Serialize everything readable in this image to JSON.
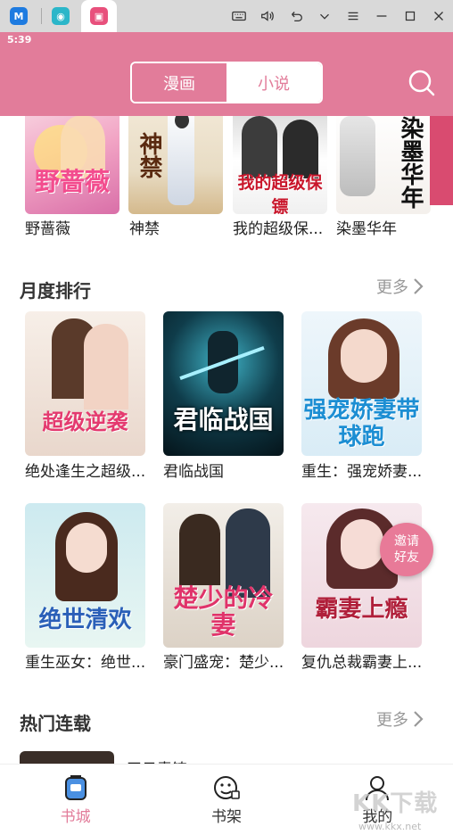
{
  "status_bar": {
    "time": "5:39"
  },
  "header": {
    "tabs": [
      {
        "label": "漫画",
        "active": false
      },
      {
        "label": "小说",
        "active": true
      }
    ],
    "accent_color": "#e27c9a"
  },
  "top_row": {
    "books": [
      {
        "name": "野蔷薇",
        "cover_text": "野蔷薇",
        "icon": "cover-image"
      },
      {
        "name": "神禁",
        "cover_text": "神禁",
        "icon": "cover-image"
      },
      {
        "name": "我的超级保...",
        "cover_text": "我的超级保镖",
        "icon": "cover-image"
      },
      {
        "name": "染墨华年",
        "cover_text": "染墨华年",
        "icon": "cover-image"
      }
    ]
  },
  "monthly": {
    "title": "月度排行",
    "more": "更多",
    "books": [
      {
        "name": "绝处逢生之超级...",
        "cover_text": "超级逆袭"
      },
      {
        "name": "君临战国",
        "cover_text": "君临战国"
      },
      {
        "name": "重生：强宠娇妻...",
        "cover_text": "强宠娇妻带球跑"
      },
      {
        "name": "重生巫女：绝世...",
        "cover_text": "绝世清欢"
      },
      {
        "name": "豪门盛宠：楚少...",
        "cover_text": "楚少的冷妻"
      },
      {
        "name": "复仇总裁霸妻上...",
        "cover_text": "霸妻上瘾"
      }
    ]
  },
  "hot": {
    "title": "热门连载",
    "more": "更多",
    "first_item": "天日青铸"
  },
  "invite": {
    "label_line1": "邀请",
    "label_line2": "好友"
  },
  "bottom_nav": [
    {
      "label": "书城",
      "icon": "bookstore-icon",
      "active": true
    },
    {
      "label": "书架",
      "icon": "bookshelf-icon",
      "active": false
    },
    {
      "label": "我的",
      "icon": "profile-icon",
      "active": false
    }
  ],
  "watermark": {
    "text": "KK下载",
    "url": "www.kkx.net"
  }
}
